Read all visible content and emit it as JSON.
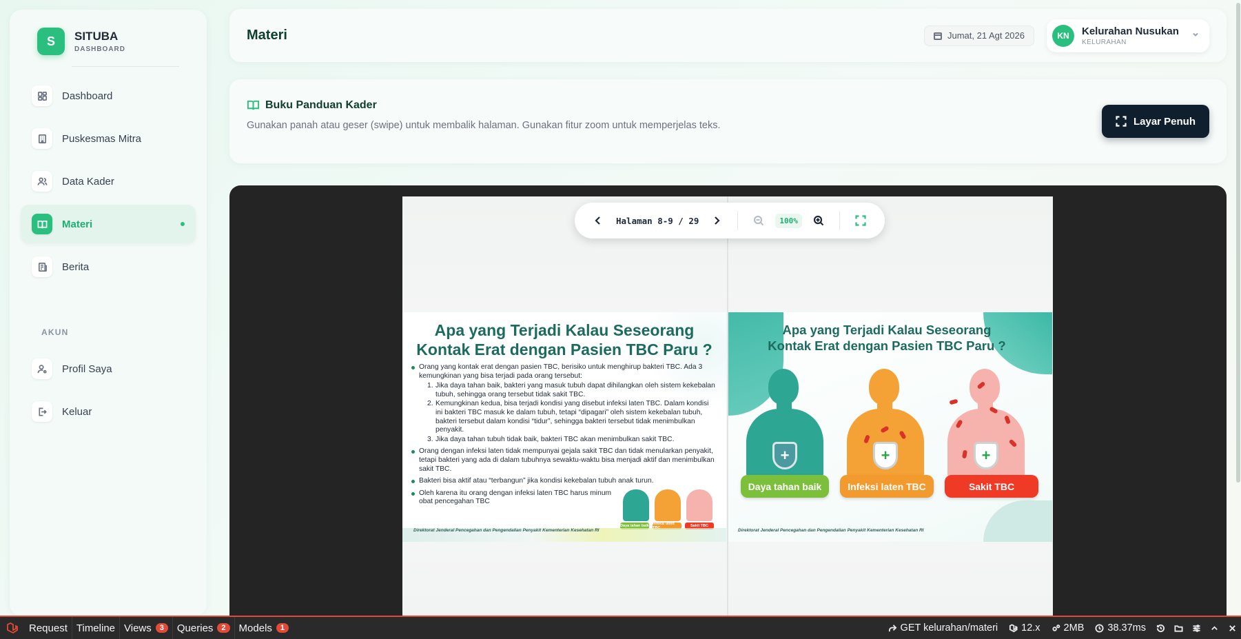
{
  "brand": {
    "name": "SITUBA",
    "subtitle": "DASHBOARD",
    "logo_letter": "S"
  },
  "sidebar": {
    "items": [
      {
        "label": "Dashboard",
        "icon": "dashboard-icon"
      },
      {
        "label": "Puskesmas Mitra",
        "icon": "building-icon"
      },
      {
        "label": "Data Kader",
        "icon": "users-icon"
      },
      {
        "label": "Materi",
        "icon": "book-icon",
        "active": true
      },
      {
        "label": "Berita",
        "icon": "newspaper-icon"
      }
    ],
    "section_label": "AKUN",
    "account_items": [
      {
        "label": "Profil Saya",
        "icon": "user-settings-icon"
      },
      {
        "label": "Keluar",
        "icon": "logout-icon"
      }
    ]
  },
  "header": {
    "title": "Materi",
    "date": "Jumat, 21 Agt 2026",
    "user": {
      "initials": "KN",
      "name": "Kelurahan Nusukan",
      "role": "KELURAHAN"
    }
  },
  "info": {
    "title": "Buku Panduan Kader",
    "description": "Gunakan panah atau geser (swipe) untuk membalik halaman. Gunakan fitur zoom untuk memperjelas teks.",
    "fullscreen_label": "Layar Penuh"
  },
  "viewer": {
    "page_indicator": "Halaman 8-9 / 29",
    "zoom": "100%",
    "left_page": {
      "heading_line1": "Apa yang Terjadi Kalau Seseorang",
      "heading_line2": "Kontak Erat dengan Pasien TBC Paru ?",
      "bullet1": "Orang yang kontak erat dengan pasien TBC, berisiko untuk menghirup bakteri TBC. Ada 3 kemungkinan yang bisa terjadi pada orang tersebut:",
      "sub1": "Jika daya tahan baik, bakteri yang masuk tubuh dapat dihilangkan oleh sistem kekebalan tubuh, sehingga orang tersebut tidak sakit TBC.",
      "sub2": "Kemungkinan kedua, bisa terjadi kondisi yang disebut infeksi laten TBC. Dalam kondisi ini bakteri TBC masuk ke dalam tubuh, tetapi “dipagari” oleh sistem kekebalan tubuh, bakteri tersebut dalam kondisi “tidur”, sehingga bakteri tersebut tidak menimbulkan penyakit.",
      "sub3": "Jika daya tahan tubuh tidak baik, bakteri TBC akan menimbulkan sakit TBC.",
      "bullet2": "Orang dengan infeksi laten tidak mempunyai gejala sakit TBC dan tidak menularkan penyakit, tetapi bakteri yang ada di dalam tubuhnya sewaktu-waktu bisa menjadi aktif dan menimbulkan sakit TBC.",
      "bullet3": "Bakteri bisa aktif atau “terbangun” jika kondisi kekebalan tubuh anak turun.",
      "bullet4": "Oleh karena itu orang dengan infeksi laten TBC harus minum obat pencegahan TBC",
      "footer": "Direktorat Jenderal Pencegahan dan Pengendalian Penyakit Kementerian Kesehatan RI"
    },
    "right_page": {
      "heading_line1": "Apa yang Terjadi Kalau Seseorang",
      "heading_line2": "Kontak Erat dengan Pasien TBC Paru ?",
      "label1": "Daya tahan baik",
      "label2": "Infeksi laten TBC",
      "label3": "Sakit TBC",
      "footer": "Direktorat Jenderal Pencegahan dan Pengendalian Penyakit Kementerian Kesehatan RI"
    }
  },
  "debugbar": {
    "tabs": [
      {
        "label": "Request"
      },
      {
        "label": "Timeline"
      },
      {
        "label": "Views",
        "count": "3"
      },
      {
        "label": "Queries",
        "count": "2"
      },
      {
        "label": "Models",
        "count": "1"
      }
    ],
    "route": "GET kelurahan/materi",
    "version": "12.x",
    "memory": "2MB",
    "time": "38.37ms"
  },
  "colors": {
    "accent": "#2bbf7f",
    "dark_button": "#0f1f2e",
    "viewer_bg": "#242424",
    "debug_accent": "#e04a37"
  }
}
